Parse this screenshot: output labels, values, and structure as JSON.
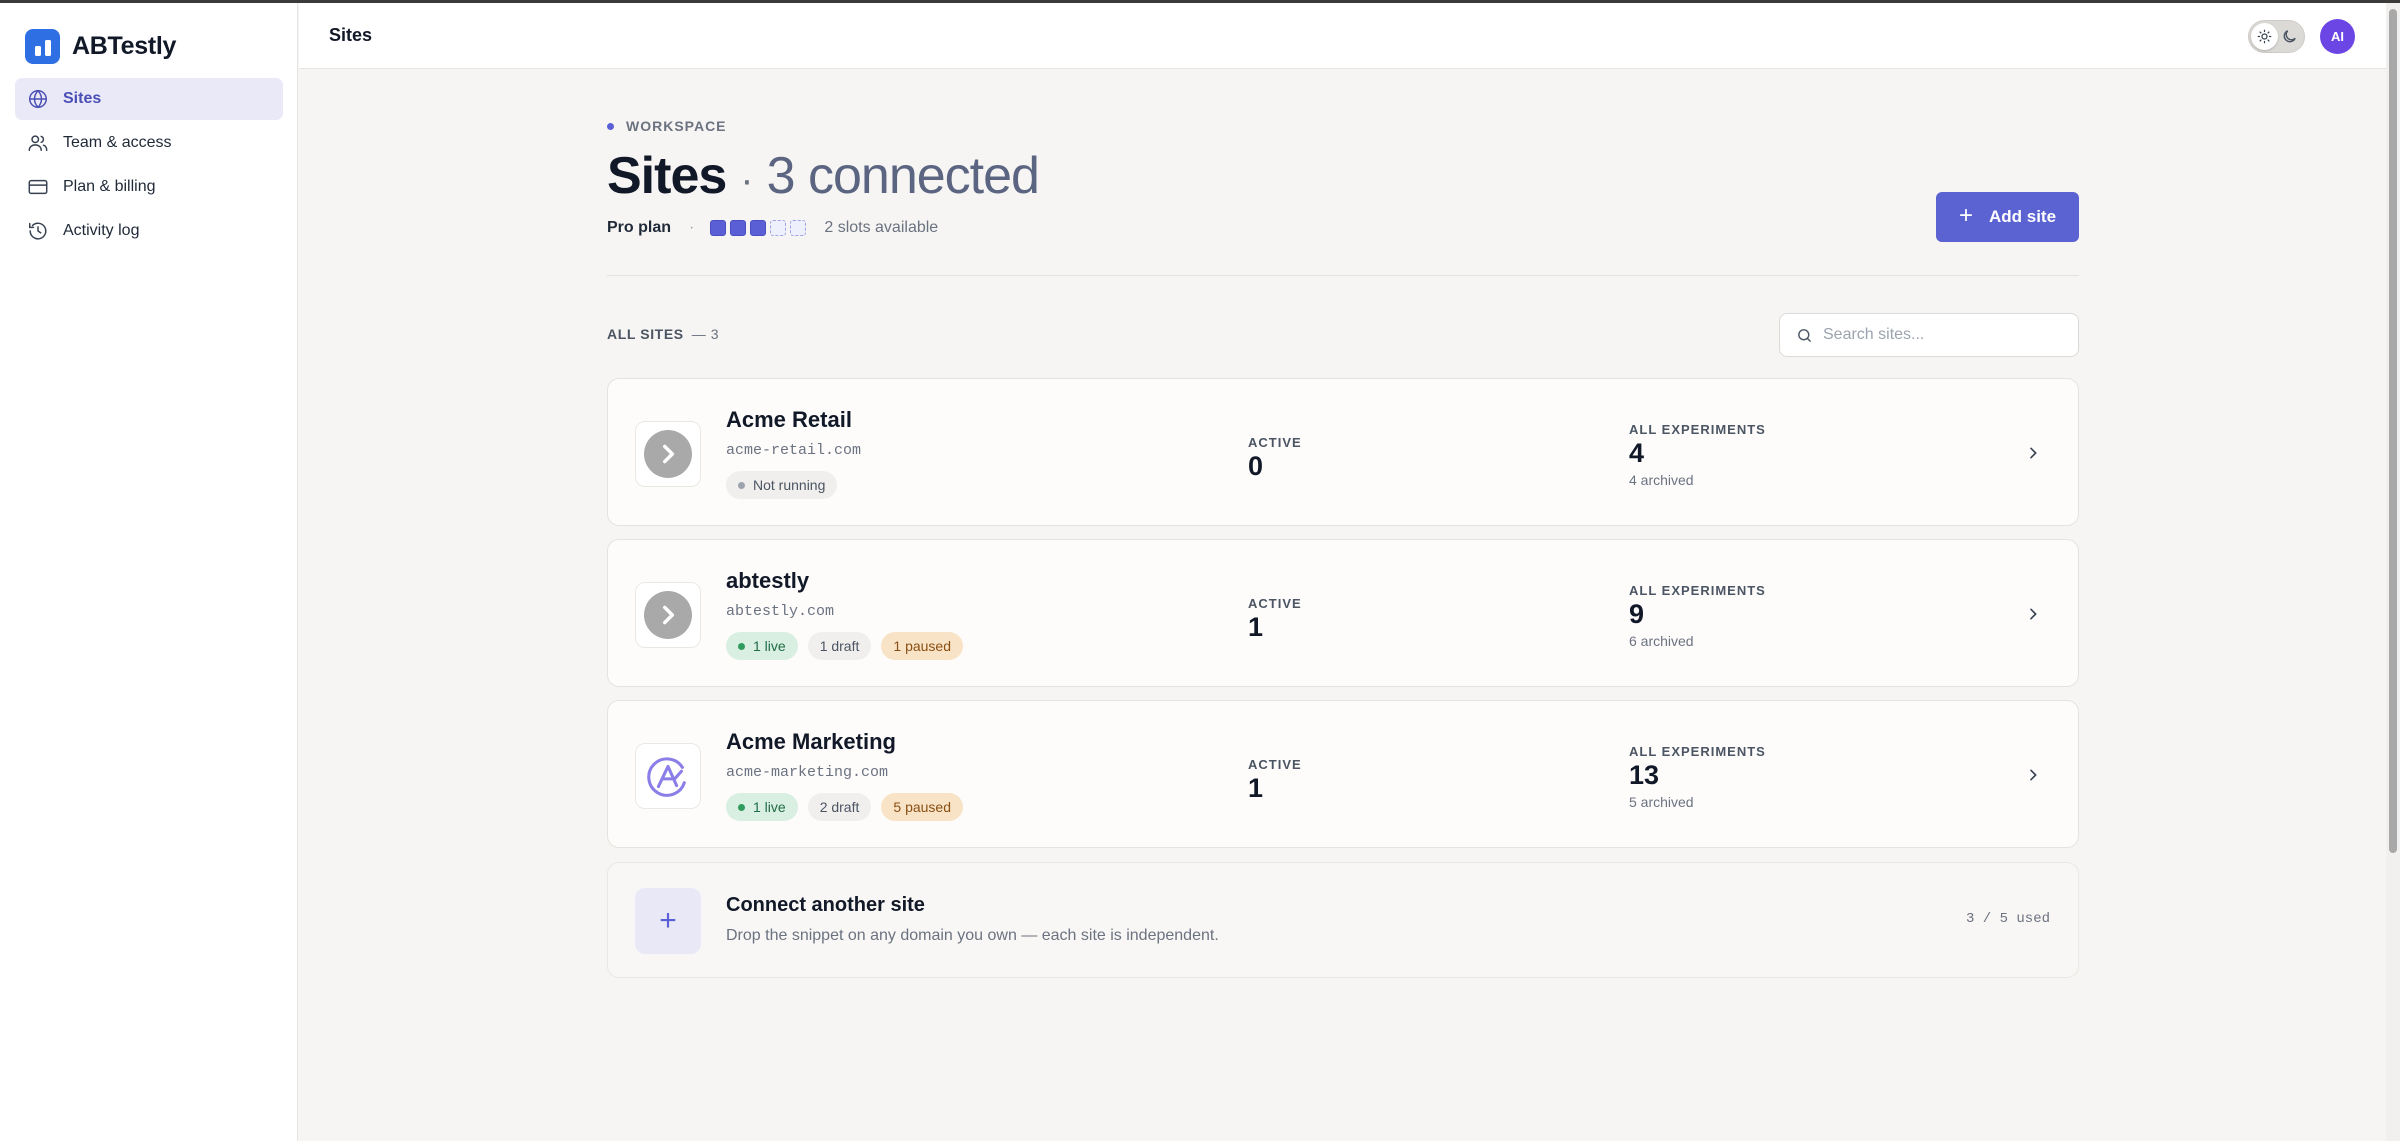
{
  "app": {
    "name": "ABTestly"
  },
  "sidebar": {
    "items": [
      {
        "label": "Sites",
        "icon": "globe-icon",
        "active": true
      },
      {
        "label": "Team & access",
        "icon": "users-icon",
        "active": false
      },
      {
        "label": "Plan & billing",
        "icon": "credit-card-icon",
        "active": false
      },
      {
        "label": "Activity log",
        "icon": "history-icon",
        "active": false
      }
    ]
  },
  "topbar": {
    "title": "Sites",
    "avatar_initials": "AI",
    "theme": "light"
  },
  "header": {
    "eyebrow": "WORKSPACE",
    "title": "Sites",
    "separator": "·",
    "subtitle": "3 connected",
    "plan_name": "Pro plan",
    "plan_separator": "·",
    "slots_used": 3,
    "slots_total": 5,
    "slots_text": "2 slots available",
    "add_button": "Add site"
  },
  "list": {
    "heading": "ALL SITES",
    "count": "— 3",
    "search_placeholder": "Search sites..."
  },
  "sites": [
    {
      "name": "Acme Retail",
      "domain": "acme-retail.com",
      "icon": "arrow-right-circle-icon",
      "badges": [
        {
          "text": "Not running",
          "tone": "gray"
        }
      ],
      "active_label": "ACTIVE",
      "active": "0",
      "experiments_label": "ALL EXPERIMENTS",
      "experiments": "4",
      "archived": "4 archived"
    },
    {
      "name": "abtestly",
      "domain": "abtestly.com",
      "icon": "arrow-right-circle-icon",
      "badges": [
        {
          "text": "1 live",
          "tone": "green"
        },
        {
          "text": "1 draft",
          "tone": "gray"
        },
        {
          "text": "1 paused",
          "tone": "amber"
        }
      ],
      "active_label": "ACTIVE",
      "active": "1",
      "experiments_label": "ALL EXPERIMENTS",
      "experiments": "9",
      "archived": "6 archived"
    },
    {
      "name": "Acme Marketing",
      "domain": "acme-marketing.com",
      "icon": "acme-marketing-logo-icon",
      "badges": [
        {
          "text": "1 live",
          "tone": "green"
        },
        {
          "text": "2 draft",
          "tone": "gray"
        },
        {
          "text": "5 paused",
          "tone": "amber"
        }
      ],
      "active_label": "ACTIVE",
      "active": "1",
      "experiments_label": "ALL EXPERIMENTS",
      "experiments": "13",
      "archived": "5 archived"
    }
  ],
  "connect": {
    "icon": "+",
    "title": "Connect another site",
    "description": "Drop the snippet on any domain you own — each site is independent.",
    "used": "3 / 5 used"
  },
  "colors": {
    "accent": "#5b63d3",
    "live": "#2f9c5e",
    "paused": "#f8e3c6",
    "avatar": "#6b46e5"
  }
}
